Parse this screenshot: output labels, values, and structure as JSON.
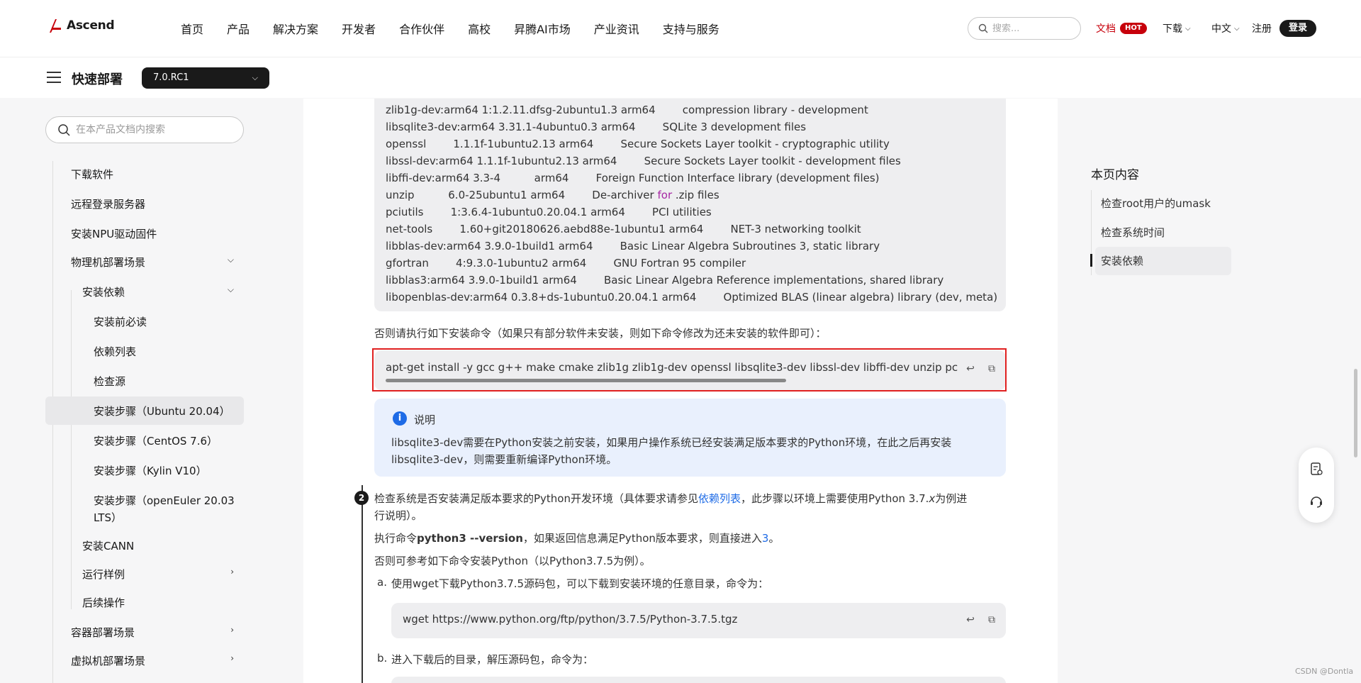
{
  "header": {
    "logo_text": "Ascend",
    "nav": [
      "首页",
      "产品",
      "解决方案",
      "开发者",
      "合作伙伴",
      "高校",
      "昇腾AI市场",
      "产业资讯",
      "支持与服务"
    ],
    "search_placeholder": "搜索...",
    "docs_label": "文档",
    "hot_badge": "HOT",
    "download_label": "下载",
    "lang_label": "中文",
    "register_label": "注册",
    "login_label": "登录"
  },
  "subbar": {
    "title": "快速部署",
    "version": "7.0.RC1"
  },
  "sidebar": {
    "search_placeholder": "在本产品文档内搜索",
    "items": [
      {
        "label": "下载软件"
      },
      {
        "label": "远程登录服务器"
      },
      {
        "label": "安装NPU驱动固件"
      },
      {
        "label": "物理机部署场景"
      },
      {
        "label": "安装依赖"
      },
      {
        "label": "安装前必读"
      },
      {
        "label": "依赖列表"
      },
      {
        "label": "检查源"
      },
      {
        "label": "安装步骤（Ubuntu 20.04）"
      },
      {
        "label": "安装步骤（CentOS 7.6）"
      },
      {
        "label": "安装步骤（Kylin V10）"
      },
      {
        "label": "安装步骤（openEuler 20.03"
      },
      {
        "label": "LTS）"
      },
      {
        "label": "安装CANN"
      },
      {
        "label": "运行样例"
      },
      {
        "label": "后续操作"
      },
      {
        "label": "容器部署场景"
      },
      {
        "label": "虚拟机部署场景"
      }
    ]
  },
  "content": {
    "pkg_lines": [
      "zlib1g-dev:arm64 1:1.2.11.dfsg-2ubuntu1.3 arm64        compression library - development",
      "libsqlite3-dev:arm64 3.31.1-4ubuntu0.3 arm64        SQLite 3 development files",
      "openssl        1.1.1f-1ubuntu2.13 arm64        Secure Sockets Layer toolkit - cryptographic utility",
      "libssl-dev:arm64 1.1.1f-1ubuntu2.13 arm64        Secure Sockets Layer toolkit - development files",
      "libffi-dev:arm64 3.3-4          arm64        Foreign Function Interface library (development files)",
      "unzip          6.0-25ubuntu1 arm64        De-archiver ",
      "pciutils        1:3.6.4-1ubuntu0.20.04.1 arm64        PCI utilities",
      "net-tools        1.60+git20180626.aebd88e-1ubuntu1 arm64        NET-3 networking toolkit",
      "libblas-dev:arm64 3.9.0-1build1 arm64        Basic Linear Algebra Subroutines 3, static library",
      "gfortran        4:9.3.0-1ubuntu2 arm64        GNU Fortran 95 compiler",
      "libblas3:arm64 3.9.0-1build1 arm64        Basic Linear Algebra Reference implementations, shared library",
      "libopenblas-dev:arm64 0.3.8+ds-1ubuntu0.20.04.1 arm64        Optimized BLAS (linear algebra) library (dev, meta)"
    ],
    "unzip_for": "for",
    "unzip_rest": " .zip files",
    "else_text": "否则请执行如下安装命令（如果只有部分软件未安装，则如下命令修改为还未安装的软件即可）：",
    "apt_cmd": "apt-get install -y gcc g++ make cmake zlib1g zlib1g-dev openssl libsqlite3-dev libssl-dev libffi-dev unzip pciut",
    "note_title": "说明",
    "note_body": "libsqlite3-dev需要在Python安装之前安装，如果用户操作系统已经安装满足版本要求的Python环境，在此之后再安装libsqlite3-dev，则需要重新编译Python环境。",
    "step_number": "2",
    "step_text_pre": "检查系统是否安装满足版本要求的Python开发环境（具体要求请参见",
    "step_link": "依赖列表",
    "step_text_post": "，此步骤以环境上需要使用Python 3.7.",
    "step_x": "x",
    "step_text_end": "为例进",
    "step_text_line2": "行说明）。",
    "exec_pre": "执行命令",
    "exec_cmd": "python3 --version",
    "exec_post": "，如果返回信息满足Python版本要求，则直接进入",
    "exec_link": "3",
    "exec_end": "。",
    "else_python": "否则可参考如下命令安装Python（以Python3.7.5为例）。",
    "sub_a_marker": "a.",
    "sub_a_text": "使用wget下载Python3.7.5源码包，可以下载到安装环境的任意目录，命令为：",
    "wget_cmd": "wget https://www.python.org/ftp/python/3.7.5/Python-3.7.5.tgz",
    "sub_b_marker": "b.",
    "sub_b_text": "进入下载后的目录，解压源码包，命令为："
  },
  "toc": {
    "title": "本页内容",
    "items": [
      "检查root用户的umask",
      "检查系统时间",
      "安装依赖"
    ]
  },
  "watermark": "CSDN @Dontla",
  "colors": {
    "accent_red": "#c7000b",
    "highlight_border": "#e02020",
    "link_blue": "#1e6be6",
    "note_bg": "#e9f0fd"
  }
}
